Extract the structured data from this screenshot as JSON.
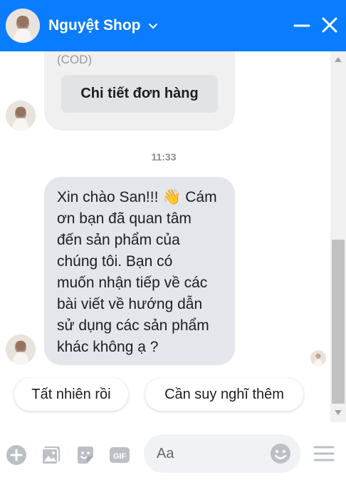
{
  "header": {
    "title": "Nguyệt Shop",
    "accent": "#0a7cff"
  },
  "order_bubble": {
    "payment_note": "(COD)",
    "details_button": "Chi tiết đơn hàng"
  },
  "timestamp": "11:33",
  "message": {
    "lines": [
      "Xin chào San!!! 👋 Cám",
      "ơn bạn đã quan tâm",
      "đến sản phẩm của",
      "chúng tôi. Bạn có",
      "muốn nhận tiếp về các",
      "bài viết về hướng dẫn",
      "sử dụng các sản phẩm",
      "khác không ạ ?"
    ]
  },
  "quick_replies": [
    "Tất nhiên rồi",
    "Cần suy nghĩ thêm"
  ],
  "composer": {
    "placeholder": "Aa",
    "icons": [
      "add-icon",
      "photo-icon",
      "sticker-icon",
      "gif-icon",
      "emoji-icon",
      "menu-icon"
    ]
  }
}
